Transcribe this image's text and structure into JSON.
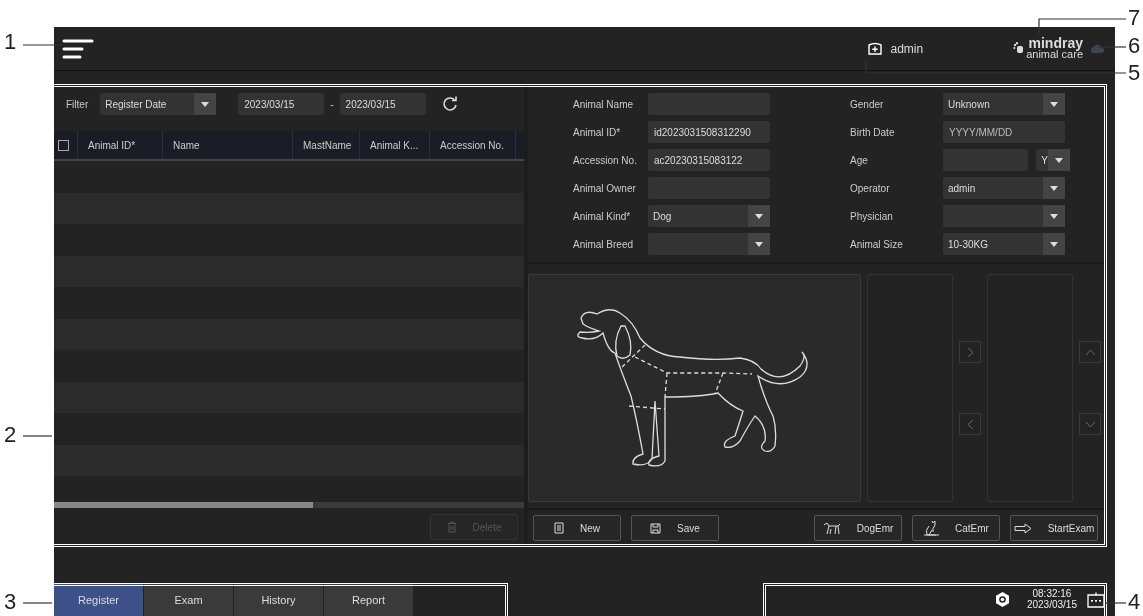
{
  "callouts": [
    "7",
    "1",
    "6",
    "5",
    "2",
    "3",
    "4"
  ],
  "top_bar": {
    "user": "admin",
    "logo_line_1": "mindray",
    "logo_line_2": "animal care"
  },
  "filter": {
    "label": "Filter",
    "field": "Register Date",
    "date_from": "2023/03/15",
    "separator": "-",
    "date_to": "2023/03/15"
  },
  "table": {
    "header_checkbox": {
      "checked": false
    },
    "columns": [
      "Animal ID*",
      "Name",
      "MastName",
      "Animal K...",
      "Accession No."
    ],
    "delete_button": {
      "label": "Delete",
      "disabled": true
    }
  },
  "form": {
    "left": [
      {
        "label": "Animal Name",
        "kind": "text"
      },
      {
        "label": "Animal ID*",
        "value": "id2023031508312290",
        "kind": "text"
      },
      {
        "label": "Accession No.",
        "value": "ac20230315083122",
        "kind": "text"
      },
      {
        "label": "Animal Owner",
        "kind": "text"
      },
      {
        "label": "Animal Kind*",
        "value": "Dog",
        "kind": "select"
      },
      {
        "label": "Animal Breed",
        "kind": "select"
      }
    ],
    "right": [
      {
        "label": "Gender",
        "value": "Unknown",
        "kind": "select"
      },
      {
        "label": "Birth Date",
        "placeholder": "YYYY/MM/DD",
        "kind": "text"
      },
      {
        "label": "Age",
        "unit": "Y",
        "kind": "age"
      },
      {
        "label": "Operator",
        "value": "admin",
        "kind": "select"
      },
      {
        "label": "Physician",
        "kind": "select"
      },
      {
        "label": "Animal Size",
        "value": "10-30KG",
        "kind": "select"
      }
    ]
  },
  "actions_left": [
    {
      "label": "New",
      "kind": "new"
    },
    {
      "label": "Save",
      "kind": "save"
    }
  ],
  "actions_right": [
    {
      "label": "DogEmr",
      "kind": "dog"
    },
    {
      "label": "CatEmr",
      "kind": "cat"
    },
    {
      "label": "StartExam",
      "kind": "start"
    }
  ],
  "tabs": [
    {
      "label": "Register",
      "selected": true
    },
    {
      "label": "Exam",
      "selected": false
    },
    {
      "label": "History",
      "selected": false
    },
    {
      "label": "Report",
      "selected": false
    }
  ],
  "status": {
    "time": "08:32:16",
    "date": "2023/03/15"
  }
}
